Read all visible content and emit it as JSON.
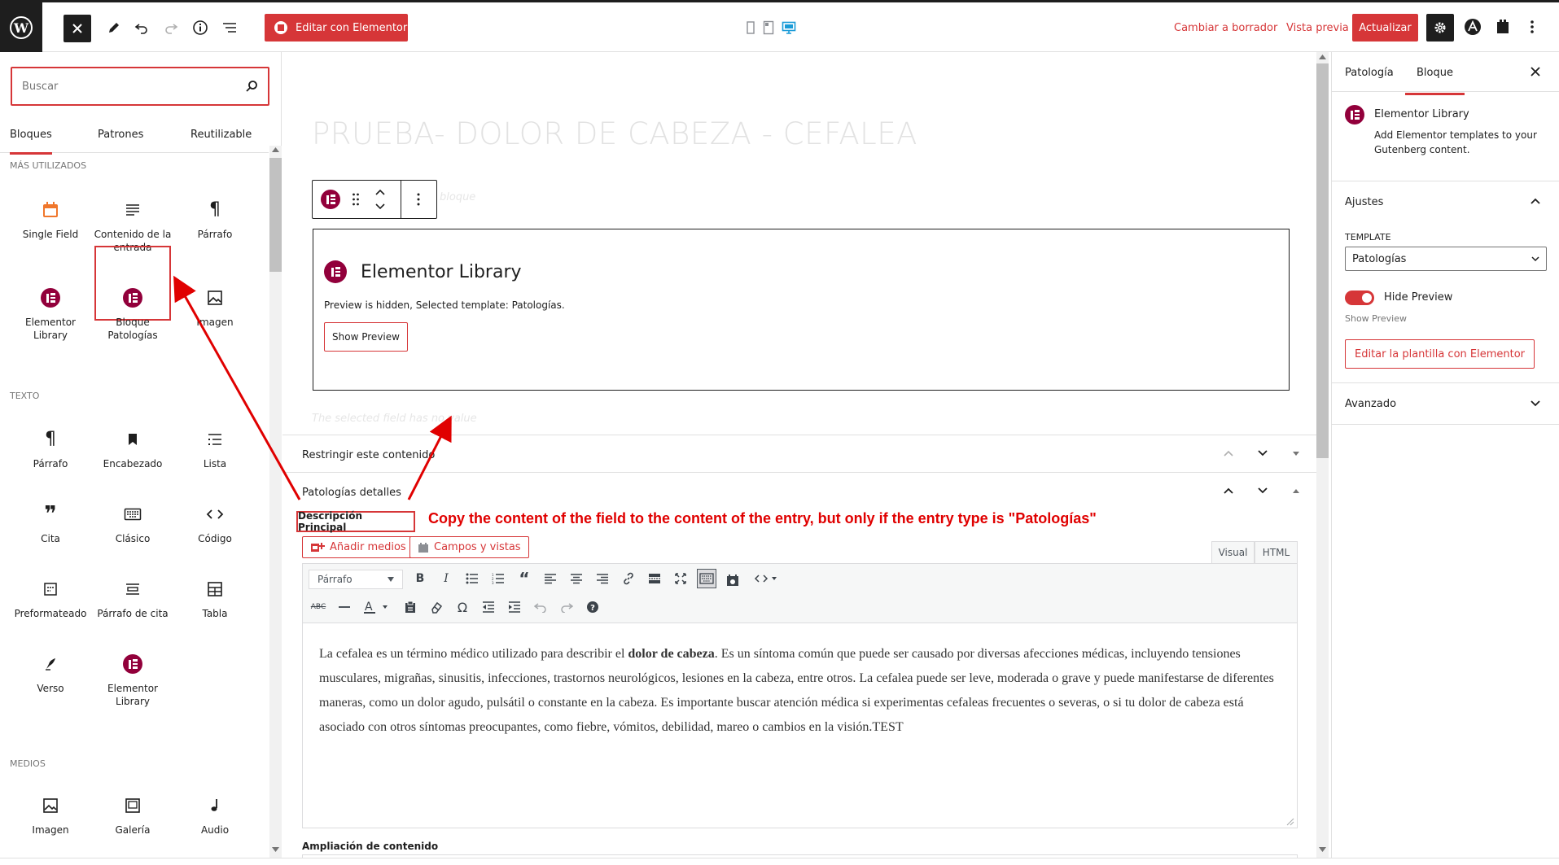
{
  "topbar": {
    "edit_elementor": "Editar con Elementor",
    "switch_draft": "Cambiar a borrador",
    "preview": "Vista previa",
    "update": "Actualizar"
  },
  "inserter": {
    "search_placeholder": "Buscar",
    "tabs": [
      "Bloques",
      "Patrones",
      "Reutilizable"
    ],
    "sections": {
      "most_used": "MÁS UTILIZADOS",
      "text": "TEXTO",
      "media": "MEDIOS"
    },
    "most_used": [
      "Single Field",
      "Contenido de la entrada",
      "Párrafo",
      "Elementor Library",
      "Bloque Patologías",
      "Imagen"
    ],
    "text": [
      "Párrafo",
      "Encabezado",
      "Lista",
      "Cita",
      "Clásico",
      "Código",
      "Preformateado",
      "Párrafo de cita",
      "Tabla",
      "Verso",
      "Elementor Library"
    ],
    "media": [
      "Imagen",
      "Galería",
      "Audio"
    ]
  },
  "editor": {
    "post_title": "PRUEBA- DOLOR DE CABEZA - CEFALEA",
    "elementor_block": {
      "title": "Elementor Library",
      "status": "Preview is hidden, Selected template: Patologías.",
      "show_preview": "Show Preview"
    },
    "ghost_placeholder": "bloque",
    "ghost_hint": "The selected field has no value",
    "metabox_restrict": "Restringir este contenido",
    "metabox_patologias": "Patologías detalles",
    "field_label": "Descripción Principal",
    "annotation": "Copy the content of the field to the content of the entry, but only if the entry type is \"Patologías\"",
    "add_media": "Añadir medios",
    "fields_views": "Campos y vistas",
    "tab_visual": "Visual",
    "tab_html": "HTML",
    "format_select": "Párrafo",
    "content_before": "La cefalea es un término médico utilizado para describir el ",
    "content_bold": "dolor de cabeza",
    "content_after": ". Es un síntoma común que puede ser causado por diversas afecciones médicas, incluyendo tensiones musculares, migrañas, sinusitis, infecciones, trastornos neurológicos, lesiones en la cabeza, entre otros. La cefalea puede ser leve, moderada o grave y puede manifestarse de diferentes maneras, como un dolor agudo, pulsátil o constante en la cabeza. Es importante buscar atención médica si experimentas cefaleas frecuentes o severas, o si tu dolor de cabeza está asociado con otros síntomas preocupantes, como fiebre, vómitos, debilidad, mareo o cambios en la visión.TEST",
    "field_label_2": "Ampliación de contenido"
  },
  "sidebar": {
    "tabs": [
      "Patología",
      "Bloque"
    ],
    "block_name": "Elementor Library",
    "block_desc": "Add Elementor templates to your Gutenberg content.",
    "settings_title": "Ajustes",
    "template_label": "TEMPLATE",
    "template_value": "Patologías",
    "hide_preview": "Hide Preview",
    "show_preview_help": "Show Preview",
    "edit_template": "Editar la plantilla con Elementor",
    "advanced": "Avanzado"
  },
  "colors": {
    "accent": "#d63638",
    "elementor": "#92003b",
    "annotation": "#e00000"
  }
}
